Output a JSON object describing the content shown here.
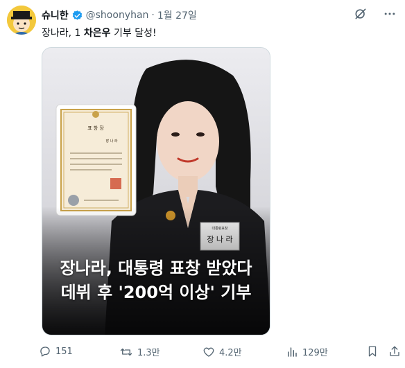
{
  "tweet": {
    "name": "슈니한",
    "handle": "@shoonyhan",
    "separator": "·",
    "date": "1월 27일",
    "text_prefix": "장나라, 1 ",
    "text_bold": "차은우",
    "text_suffix": " 기부 달성!"
  },
  "media": {
    "caption_line1": "장나라, 대통령 표창 받았다",
    "caption_line2": "데뷔 후 '200억 이상' 기부",
    "certificate_title": "표 창 장",
    "certificate_name": "장 나 라",
    "name_tag": "장 나 라"
  },
  "actions": {
    "replies": "151",
    "retweets": "1.3만",
    "likes": "4.2만",
    "views": "129만"
  },
  "icons": {
    "verified": "verified-badge-icon",
    "grok": "grok-icon",
    "more": "more-icon",
    "reply": "reply-icon",
    "retweet": "retweet-icon",
    "like": "heart-icon",
    "views": "views-icon",
    "bookmark": "bookmark-icon",
    "share": "share-icon"
  },
  "colors": {
    "text_primary": "#0f1419",
    "text_secondary": "#536471",
    "verified_blue": "#1d9bf0"
  }
}
